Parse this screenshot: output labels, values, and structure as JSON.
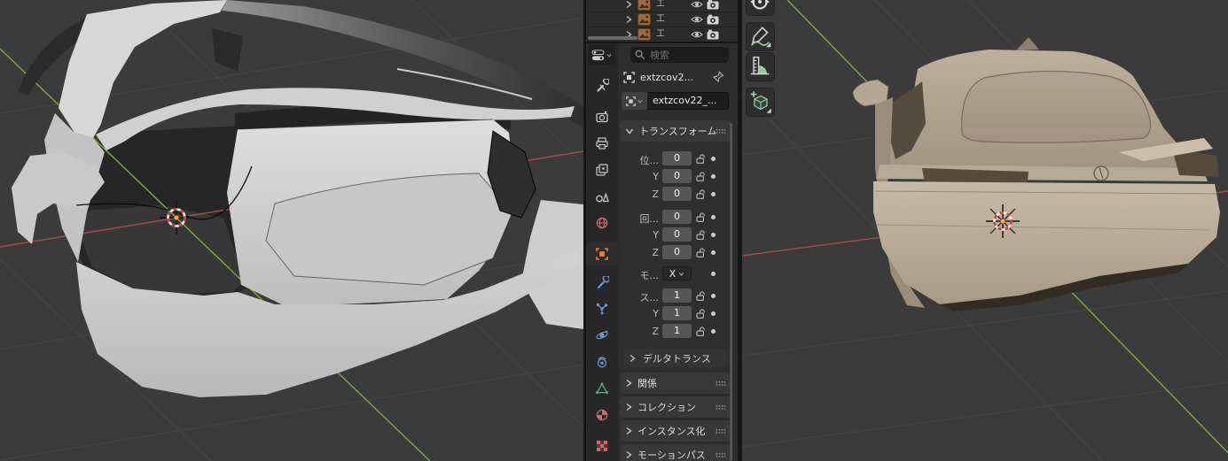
{
  "outliner": {
    "rows": [
      {
        "icon": "image-icon",
        "name": "工"
      },
      {
        "icon": "image-icon",
        "name": "工"
      },
      {
        "icon": "image-icon",
        "name": "工"
      }
    ],
    "row_icons": [
      "disclosure-chevron",
      "image-icon",
      "visibility-eye-icon",
      "render-camera-icon"
    ]
  },
  "properties": {
    "search_placeholder": "検索",
    "breadcrumb": {
      "object": "extzcov2..."
    },
    "name_field": {
      "value": "extzcov22_..."
    },
    "tabs": [
      {
        "icon": "tool-icon"
      },
      {
        "icon": "render-icon"
      },
      {
        "icon": "output-icon"
      },
      {
        "icon": "view-layer-icon"
      },
      {
        "icon": "scene-icon"
      },
      {
        "icon": "world-icon"
      },
      {
        "icon": "object-icon",
        "active": true
      },
      {
        "icon": "modifiers-icon"
      },
      {
        "icon": "particles-icon"
      },
      {
        "icon": "physics-icon"
      },
      {
        "icon": "constraints-icon"
      },
      {
        "icon": "object-data-icon"
      },
      {
        "icon": "material-icon"
      },
      {
        "icon": "texture-icon"
      }
    ],
    "transform": {
      "title": "トランスフォーム",
      "rows": [
        {
          "label": "位...",
          "value": "0"
        },
        {
          "label": "Y",
          "value": "0"
        },
        {
          "label": "Z",
          "value": "0"
        },
        {
          "label": "回...",
          "value": "0"
        },
        {
          "label": "Y",
          "value": "0"
        },
        {
          "label": "Z",
          "value": "0"
        },
        {
          "label": "モ...",
          "value": "X"
        },
        {
          "label": "ス...",
          "value": "1"
        },
        {
          "label": "Y",
          "value": "1"
        },
        {
          "label": "Z",
          "value": "1"
        }
      ],
      "subpanel": "デルタトランス"
    },
    "panels": [
      {
        "label": "関係"
      },
      {
        "label": "コレクション"
      },
      {
        "label": "インスタンス化"
      },
      {
        "label": "モーションパス"
      }
    ]
  },
  "toolbar": {
    "tools": [
      "transform-tool",
      "annotate-tool",
      "measure-tool",
      "add-cube-tool"
    ]
  },
  "colors": {
    "accent_orange": "#e8823c",
    "axis_red": "#a9494f",
    "axis_green": "#7aac3c",
    "cursor_red": "#cc3b44",
    "car_gray": "#d3d3d3",
    "car_tan": "#b3a58f",
    "viewport_bg": "#3b3b3b"
  }
}
